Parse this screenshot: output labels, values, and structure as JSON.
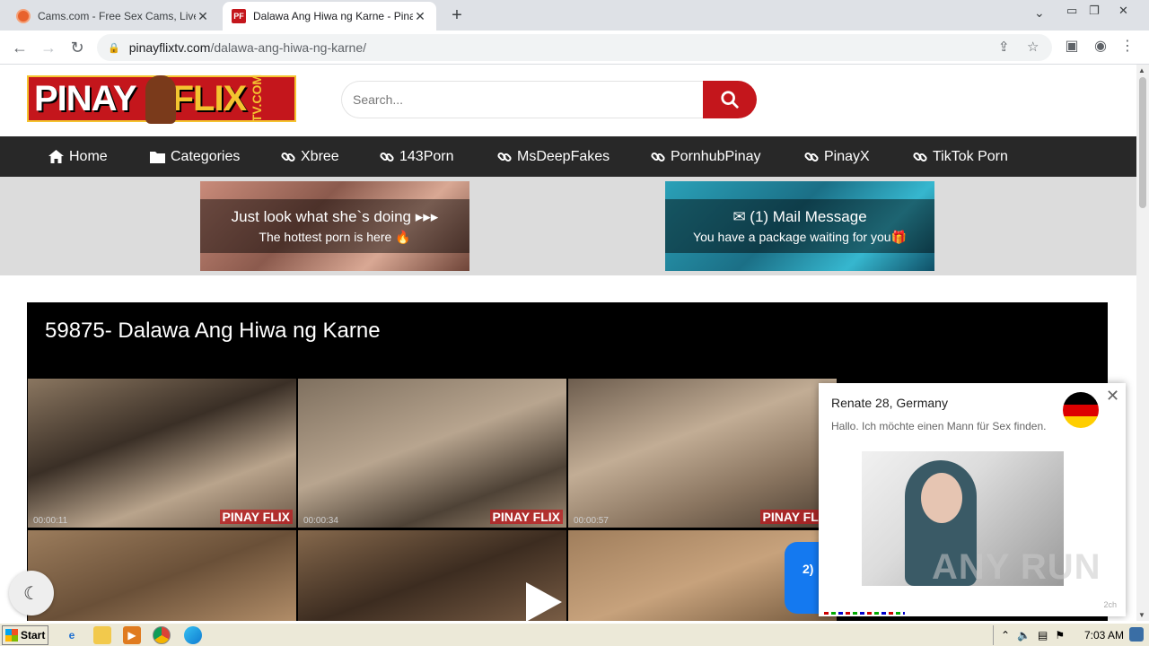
{
  "browser": {
    "tabs": [
      {
        "title": "Cams.com - Free Sex Cams, Live Se",
        "active": false,
        "favicon_color": "#e8622c"
      },
      {
        "title": "Dalawa Ang Hiwa ng Karne - PinayFl",
        "active": true,
        "favicon_color": "#c4161c",
        "favicon_text": "PF"
      }
    ],
    "new_tab_label": "+",
    "address": {
      "host": "pinayflixtv.com",
      "path": "/dalawa-ang-hiwa-ng-karne/"
    }
  },
  "site": {
    "logo": {
      "part1": "PINAY",
      "part2": "FLIX",
      "part3": "TV.COM"
    },
    "search": {
      "placeholder": "Search..."
    },
    "nav": [
      {
        "label": "Home",
        "icon": "home-icon"
      },
      {
        "label": "Categories",
        "icon": "folder-icon"
      },
      {
        "label": "Xbree",
        "icon": "link-icon"
      },
      {
        "label": "143Porn",
        "icon": "link-icon"
      },
      {
        "label": "MsDeepFakes",
        "icon": "link-icon"
      },
      {
        "label": "PornhubPinay",
        "icon": "link-icon"
      },
      {
        "label": "PinayX",
        "icon": "link-icon"
      },
      {
        "label": "TikTok Porn",
        "icon": "link-icon"
      }
    ],
    "ads": [
      {
        "line1": "Just look what she`s doing ▸▸▸",
        "line2": "The hottest porn is here 🔥"
      },
      {
        "line1": "✉ (1) Mail Message",
        "line2": "You have a package waiting for you🎁"
      }
    ],
    "video": {
      "title": "59875- Dalawa Ang Hiwa ng Karne",
      "thumbs": [
        {
          "time": "00:00:11",
          "watermark": "PINAY FLIX"
        },
        {
          "time": "00:00:34",
          "watermark": "PINAY FLIX"
        },
        {
          "time": "00:00:57",
          "watermark": "PINAY FLIX"
        }
      ]
    },
    "popup": {
      "name": "Renate 28, Germany",
      "message": "Hallo. Ich möchte einen Mann für Sex finden.",
      "ago": "2ch"
    },
    "blue_badge": "2)",
    "watermark": "ANY RUN"
  },
  "taskbar": {
    "start_label": "Start",
    "clock": "7:03 AM"
  },
  "colors": {
    "brand_red": "#c4161c",
    "nav_bg": "#282828",
    "ad_band": "#dcdcdc"
  }
}
